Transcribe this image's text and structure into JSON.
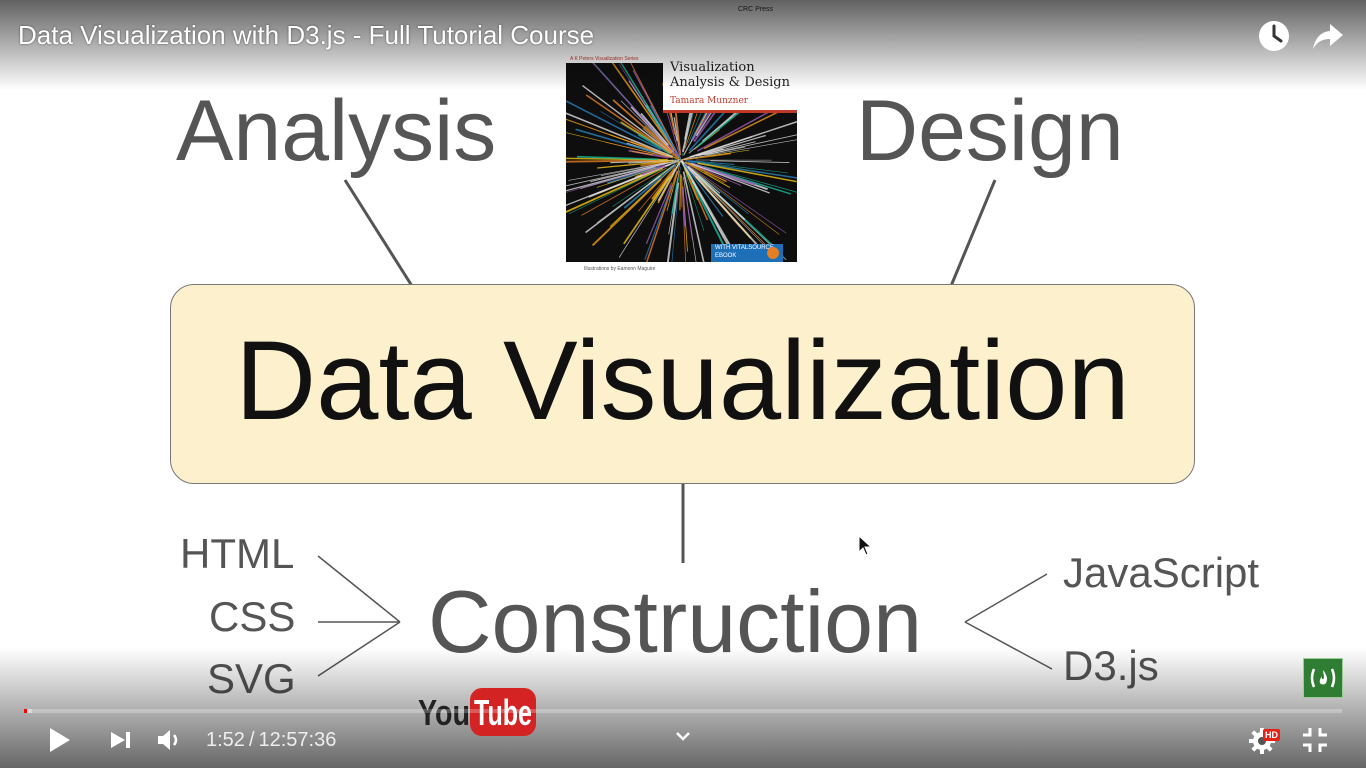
{
  "video": {
    "title": "Data Visualization with D3.js - Full Tutorial Course"
  },
  "slide": {
    "top_left": "Analysis",
    "top_right": "Design",
    "center": "Data Visualization",
    "bottom": "Construction",
    "left_techs": [
      "HTML",
      "CSS",
      "SVG"
    ],
    "right_techs": [
      "JavaScript",
      "D3.js"
    ]
  },
  "book_cover": {
    "series": "A K Peters Visualization Series",
    "title_line1": "Visualization",
    "title_line2": "Analysis & Design",
    "author": "Tamara Munzner",
    "publisher": "CRC Press",
    "ebook_badge": "WITH VITALSOURCE EBOOK",
    "illustrations": "Illustrations by Eamonn Maguire"
  },
  "controls": {
    "current_time": "1:52",
    "duration": "12:57:36",
    "separator": "/",
    "progress_played_fraction": 0.0024,
    "hd_label": "HD"
  },
  "logos": {
    "youtube_you": "You",
    "youtube_tube": "Tube"
  },
  "icons": {
    "watch_later": "clock-icon",
    "share": "share-arrow-icon",
    "play": "play-icon",
    "next": "skip-next-icon",
    "volume": "volume-icon",
    "settings": "gear-icon",
    "exit_fullscreen": "exit-fullscreen-icon",
    "chevron": "chevron-down-icon",
    "channel": "freecodecamp-icon"
  },
  "colors": {
    "progress_played": "#ff0000",
    "box_fill": "#fdf0cd",
    "hd_badge": "#e62117",
    "channel_badge": "#2e7d32"
  }
}
